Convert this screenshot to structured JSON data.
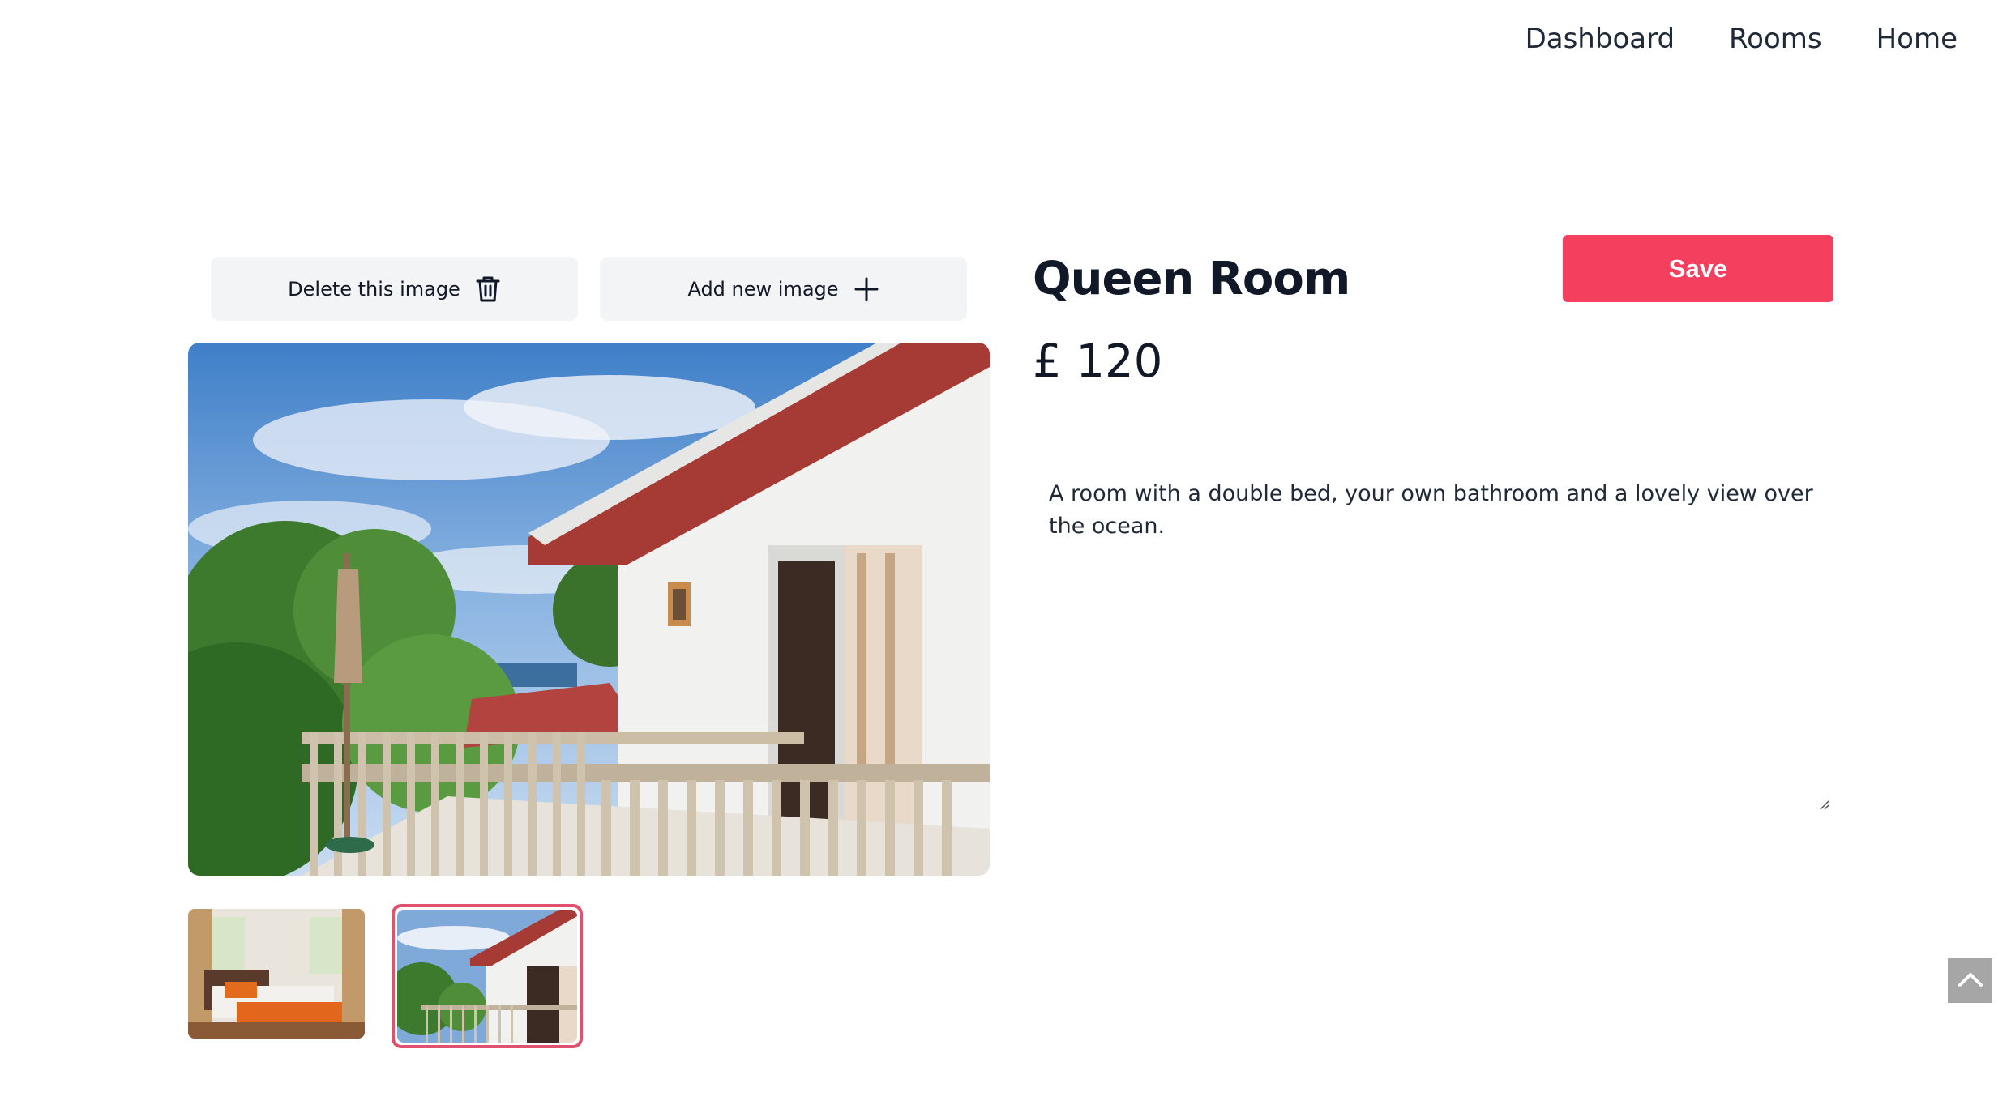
{
  "nav": {
    "items": [
      {
        "label": "Dashboard"
      },
      {
        "label": "Rooms"
      },
      {
        "label": "Home"
      }
    ]
  },
  "toolbar": {
    "delete_label": "Delete this image",
    "delete_icon": "trash-icon",
    "add_label": "Add new image",
    "add_icon": "plus-icon"
  },
  "room": {
    "title": "Queen Room",
    "price": "£ 120",
    "description": "A room with a double bed, your own bathroom and a lovely view over the ocean."
  },
  "actions": {
    "save_label": "Save"
  },
  "gallery": {
    "selected_index": 1,
    "thumbnails": [
      {
        "icon": "bedroom-photo"
      },
      {
        "icon": "balcony-photo"
      }
    ]
  },
  "colors": {
    "accent": "#f43f5e",
    "selected_border": "#e0516d",
    "button_bg": "#f3f4f6",
    "scroll_top_bg": "#a6a6a6"
  }
}
